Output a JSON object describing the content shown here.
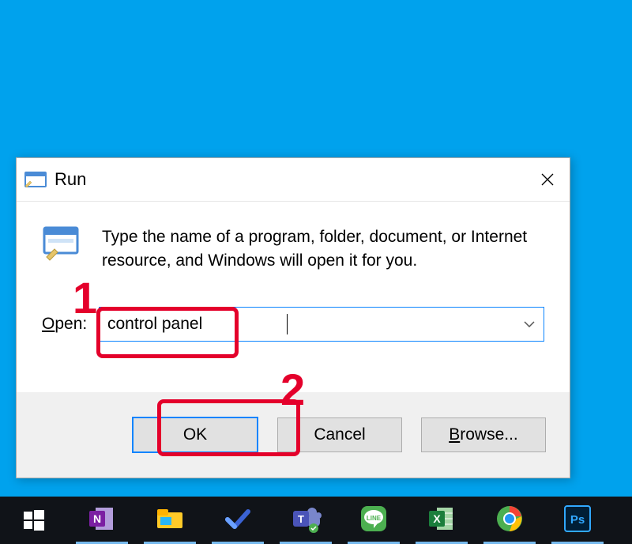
{
  "dialog": {
    "title": "Run",
    "description": "Type the name of a program, folder, document, or Internet resource, and Windows will open it for you.",
    "open_label_prefix": "O",
    "open_label_rest": "pen:",
    "input_value": "control panel",
    "buttons": {
      "ok": "OK",
      "cancel": "Cancel",
      "browse_prefix": "B",
      "browse_rest": "rowse..."
    }
  },
  "annotations": {
    "one": "1",
    "two": "2"
  },
  "taskbar": {
    "items": [
      "start",
      "onenote",
      "file-explorer",
      "todo",
      "teams",
      "line",
      "excel",
      "chrome",
      "photoshop"
    ]
  }
}
